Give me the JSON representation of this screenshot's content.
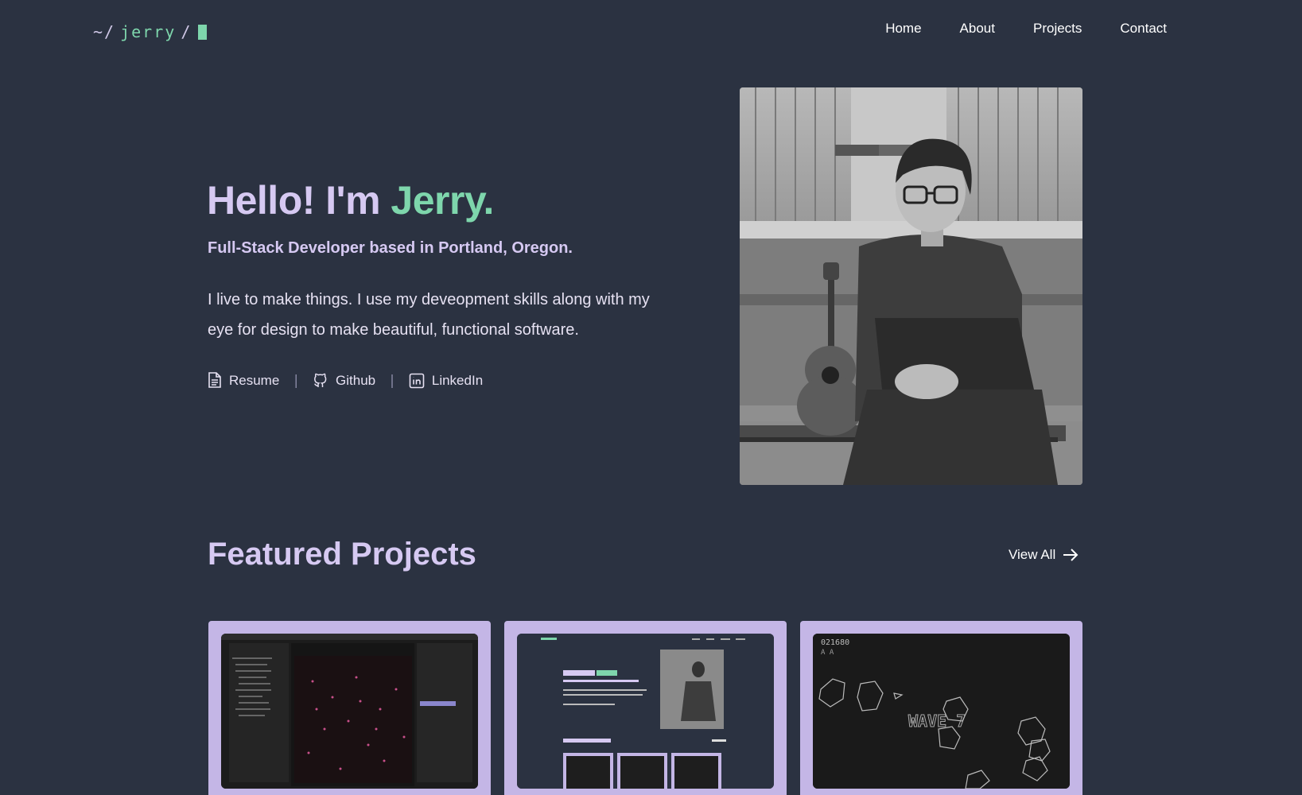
{
  "nav": {
    "logo": {
      "prefix": "~/",
      "name": "jerry",
      "suffix": "/"
    },
    "links": [
      {
        "label": "Home"
      },
      {
        "label": "About"
      },
      {
        "label": "Projects"
      },
      {
        "label": "Contact"
      }
    ]
  },
  "hero": {
    "title_prefix": "Hello! I'm ",
    "title_name": "Jerry.",
    "subtitle": "Full-Stack Developer based in Portland, Oregon.",
    "description": "I live to make things. I use my deveopment skills along with my eye for design to make beautiful, functional software.",
    "links": [
      {
        "label": "Resume",
        "icon": "document-icon"
      },
      {
        "label": "Github",
        "icon": "github-icon"
      },
      {
        "label": "LinkedIn",
        "icon": "linkedin-icon"
      }
    ],
    "separator": "|"
  },
  "featured": {
    "title": "Featured Projects",
    "view_all": "View All",
    "cards": [
      {
        "image": "image-editor-app-screenshot"
      },
      {
        "image": "portfolio-site-screenshot"
      },
      {
        "image": "asteroids-game-screenshot",
        "score": "021680",
        "lives": "A A",
        "wave": "WAVE 7"
      }
    ]
  },
  "colors": {
    "background": "#2b3241",
    "accent": "#7ed6ac",
    "heading": "#d6c9f2",
    "card": "#c4b6e6"
  }
}
